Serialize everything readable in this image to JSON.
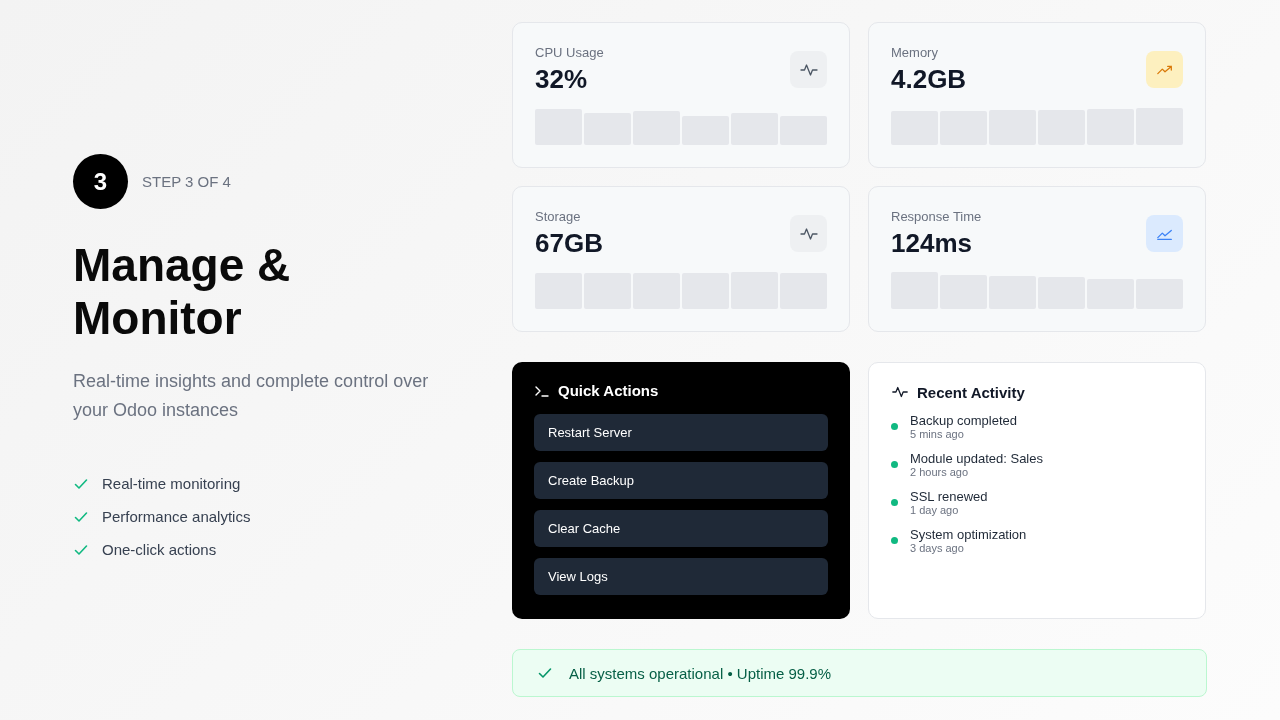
{
  "step": {
    "number": "3",
    "label": "STEP 3 OF 4"
  },
  "heading": "Manage & Monitor",
  "subtitle": "Real-time insights and complete control over your Odoo instances",
  "features": [
    "Real-time monitoring",
    "Performance analytics",
    "One-click actions"
  ],
  "metrics": [
    {
      "label": "CPU Usage",
      "value": "32%",
      "kind": "pulse"
    },
    {
      "label": "Memory",
      "value": "4.2GB",
      "kind": "trend"
    },
    {
      "label": "Storage",
      "value": "67GB",
      "kind": "pulse"
    },
    {
      "label": "Response Time",
      "value": "124ms",
      "kind": "latency"
    }
  ],
  "quick_actions": {
    "title": "Quick Actions",
    "buttons": [
      "Restart Server",
      "Create Backup",
      "Clear Cache",
      "View Logs"
    ]
  },
  "recent_activity": {
    "title": "Recent Activity",
    "items": [
      {
        "text": "Backup completed",
        "time": "5 mins ago"
      },
      {
        "text": "Module updated: Sales",
        "time": "2 hours ago"
      },
      {
        "text": "SSL renewed",
        "time": "1 day ago"
      },
      {
        "text": "System optimization",
        "time": "3 days ago"
      }
    ]
  },
  "status_bar": "All systems operational • Uptime 99.9%"
}
